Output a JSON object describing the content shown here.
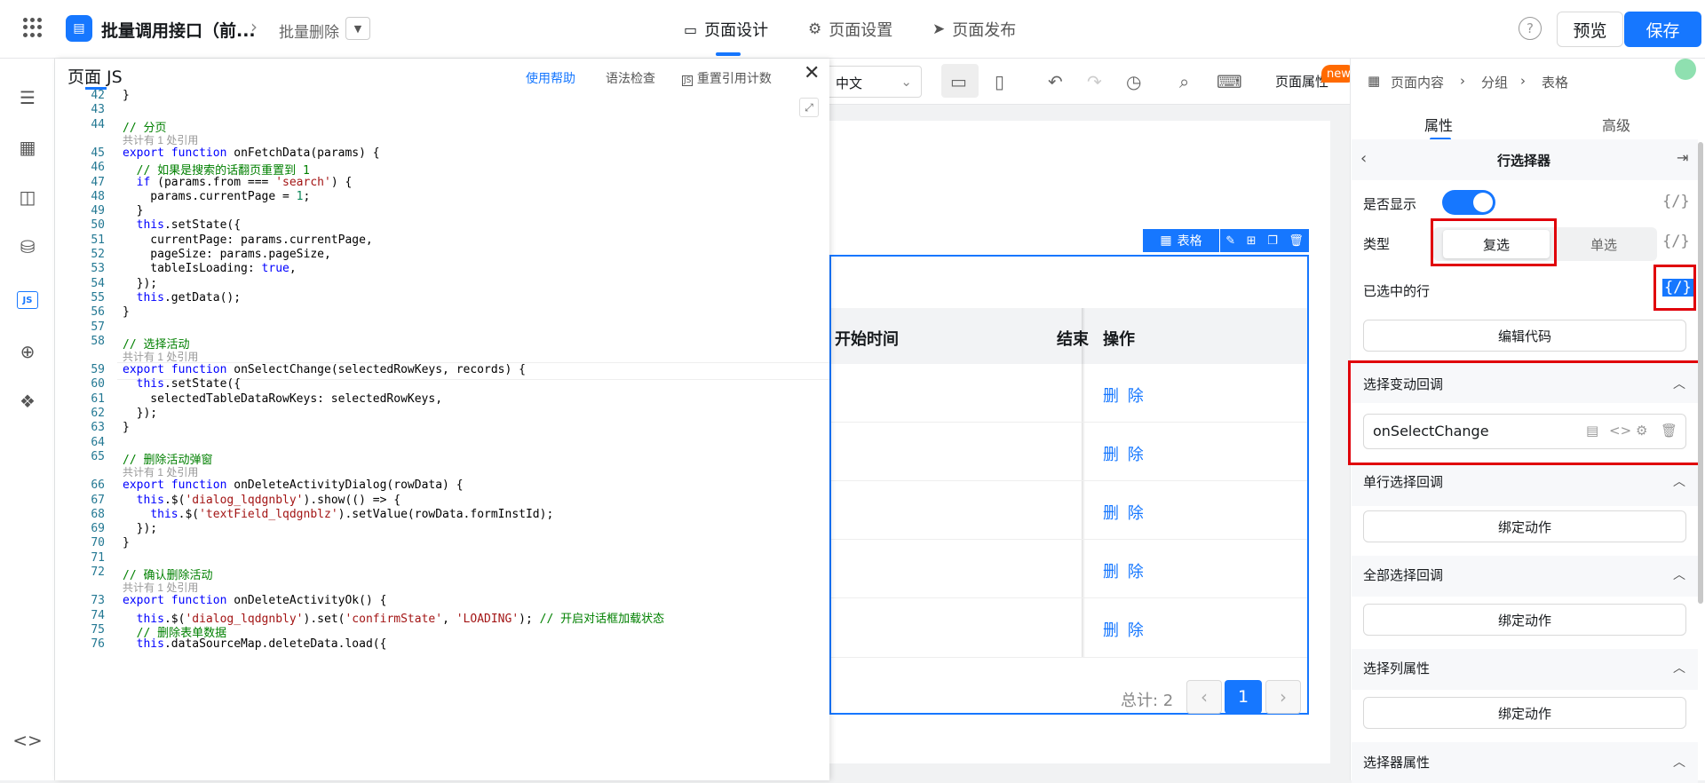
{
  "header": {
    "app_name": "批量调用接口（前...",
    "page_name": "批量删除",
    "tabs": [
      {
        "label": "页面设计",
        "icon": "layout-icon"
      },
      {
        "label": "页面设置",
        "icon": "gear-icon"
      },
      {
        "label": "页面发布",
        "icon": "send-icon"
      }
    ],
    "preview_label": "预览",
    "save_label": "保存",
    "help": "?"
  },
  "js_panel": {
    "title": "页面 JS",
    "use_help": "使用帮助",
    "syntax_check": "语法检查",
    "reset_ref": "重置引用计数",
    "js_badge": "JS"
  },
  "code": {
    "ref_note": "共计有 1 处引用",
    "lines": [
      {
        "n": "42",
        "t": "}"
      },
      {
        "n": "43",
        "t": ""
      },
      {
        "n": "44",
        "t": "// 分页"
      },
      {
        "n": "45",
        "t": "export function onFetchData(params) {"
      },
      {
        "n": "46",
        "t": "  // 如果是搜索的话翻页重置到 1"
      },
      {
        "n": "47",
        "t": "  if (params.from === 'search') {"
      },
      {
        "n": "48",
        "t": "    params.currentPage = 1;"
      },
      {
        "n": "49",
        "t": "  }"
      },
      {
        "n": "50",
        "t": "  this.setState({"
      },
      {
        "n": "51",
        "t": "    currentPage: params.currentPage,"
      },
      {
        "n": "52",
        "t": "    pageSize: params.pageSize,"
      },
      {
        "n": "53",
        "t": "    tableIsLoading: true,"
      },
      {
        "n": "54",
        "t": "  });"
      },
      {
        "n": "55",
        "t": "  this.getData();"
      },
      {
        "n": "56",
        "t": "}"
      },
      {
        "n": "57",
        "t": ""
      },
      {
        "n": "58",
        "t": "// 选择活动"
      },
      {
        "n": "59",
        "t": "export function onSelectChange(selectedRowKeys, records) {"
      },
      {
        "n": "60",
        "t": "  this.setState({"
      },
      {
        "n": "61",
        "t": "    selectedTableDataRowKeys: selectedRowKeys,"
      },
      {
        "n": "62",
        "t": "  });"
      },
      {
        "n": "63",
        "t": "}"
      },
      {
        "n": "64",
        "t": ""
      },
      {
        "n": "65",
        "t": "// 删除活动弹窗"
      },
      {
        "n": "66",
        "t": "export function onDeleteActivityDialog(rowData) {"
      },
      {
        "n": "67",
        "t": "  this.$('dialog_lqdgnbly').show(() => {"
      },
      {
        "n": "68",
        "t": "    this.$('textField_lqdgnblz').setValue(rowData.formInstId);"
      },
      {
        "n": "69",
        "t": "  });"
      },
      {
        "n": "70",
        "t": "}"
      },
      {
        "n": "71",
        "t": ""
      },
      {
        "n": "72",
        "t": "// 确认删除活动"
      },
      {
        "n": "73",
        "t": "export function onDeleteActivityOk() {"
      },
      {
        "n": "74",
        "t": "  this.$('dialog_lqdgnbly').set('confirmState', 'LOADING'); // 开启对话框加载状态"
      },
      {
        "n": "75",
        "t": "  // 删除表单数据"
      },
      {
        "n": "76",
        "t": "  this.dataSourceMap.deleteData.load({"
      }
    ]
  },
  "canvas": {
    "lang": "中文",
    "page_attr": "页面属性",
    "new_badge": "new",
    "table_tag": "表格",
    "columns": [
      "开始时间",
      "结束",
      "操作"
    ],
    "row_action": "删 除",
    "total": "总计: 2",
    "current_page": "1"
  },
  "props": {
    "breadcrumb": [
      "页面内容",
      "分组",
      "表格"
    ],
    "tabs": [
      "属性",
      "高级"
    ],
    "section_title": "行选择器",
    "show_label": "是否显示",
    "show_value": true,
    "type_label": "类型",
    "type_options": [
      "复选",
      "单选"
    ],
    "selected_rows_label": "已选中的行",
    "edit_code": "编辑代码",
    "expr_icon": "{/}",
    "on_change_title": "选择变动回调",
    "on_change_value": "onSelectChange",
    "single_cb_title": "单行选择回调",
    "all_cb_title": "全部选择回调",
    "col_props_title": "选择列属性",
    "selector_props_title": "选择器属性",
    "bind_action": "绑定动作"
  },
  "colors": {
    "accent": "#1677ff",
    "highlight": "#e0000a"
  }
}
